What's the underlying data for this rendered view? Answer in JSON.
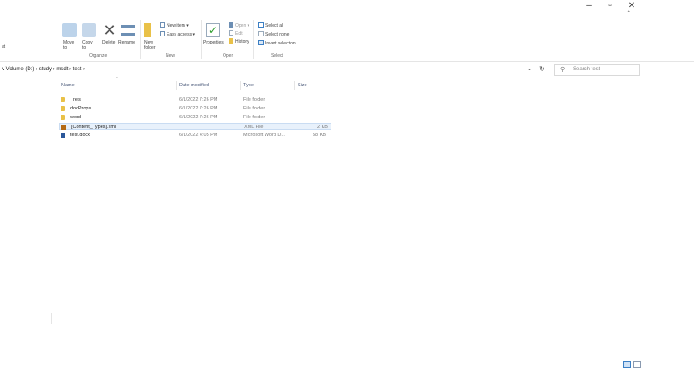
{
  "window": {
    "minimize_glyph": "–",
    "maximize_glyph": "▫",
    "close_glyph": "✕",
    "collapse_glyph": "^",
    "help_glyph": "?"
  },
  "ribbon": {
    "clipboard_edge": "at",
    "move_to": "Move\nto",
    "copy_to": "Copy\nto",
    "delete": "Delete",
    "rename": "Rename",
    "new_folder": "New\nfolder",
    "new_item": "New item ▾",
    "easy_access": "Easy access ▾",
    "properties": "Properties",
    "open": "Open ▾",
    "edit": "Edit",
    "history": "History",
    "select_all": "Select all",
    "select_none": "Select none",
    "invert_selection": "Invert selection",
    "groups": {
      "organize": "Organize",
      "new": "New",
      "open": "Open",
      "select": "Select"
    }
  },
  "address": {
    "path": [
      "v Volume (D:)",
      "study",
      "msdt",
      "test"
    ],
    "search_placeholder": "Search test"
  },
  "columns": {
    "name": "Name",
    "date": "Date modified",
    "type": "Type",
    "size": "Size"
  },
  "files": [
    {
      "name": "_rels",
      "date": "6/1/2022 7:26 PM",
      "type": "File folder",
      "size": "",
      "kind": "folder"
    },
    {
      "name": "docProps",
      "date": "6/1/2022 7:26 PM",
      "type": "File folder",
      "size": "",
      "kind": "folder"
    },
    {
      "name": "word",
      "date": "6/1/2022 7:26 PM",
      "type": "File folder",
      "size": "",
      "kind": "folder"
    },
    {
      "name": "[Content_Types].xml",
      "date": "",
      "type": "XML File",
      "size": "2 KB",
      "kind": "xml"
    },
    {
      "name": "test.docx",
      "date": "6/1/2022 4:05 PM",
      "type": "Microsoft Word D...",
      "size": "58 KB",
      "kind": "word"
    }
  ],
  "colors": {
    "accent": "#0078d7",
    "selection": "#e8f1fb",
    "folder": "#e9c148"
  }
}
